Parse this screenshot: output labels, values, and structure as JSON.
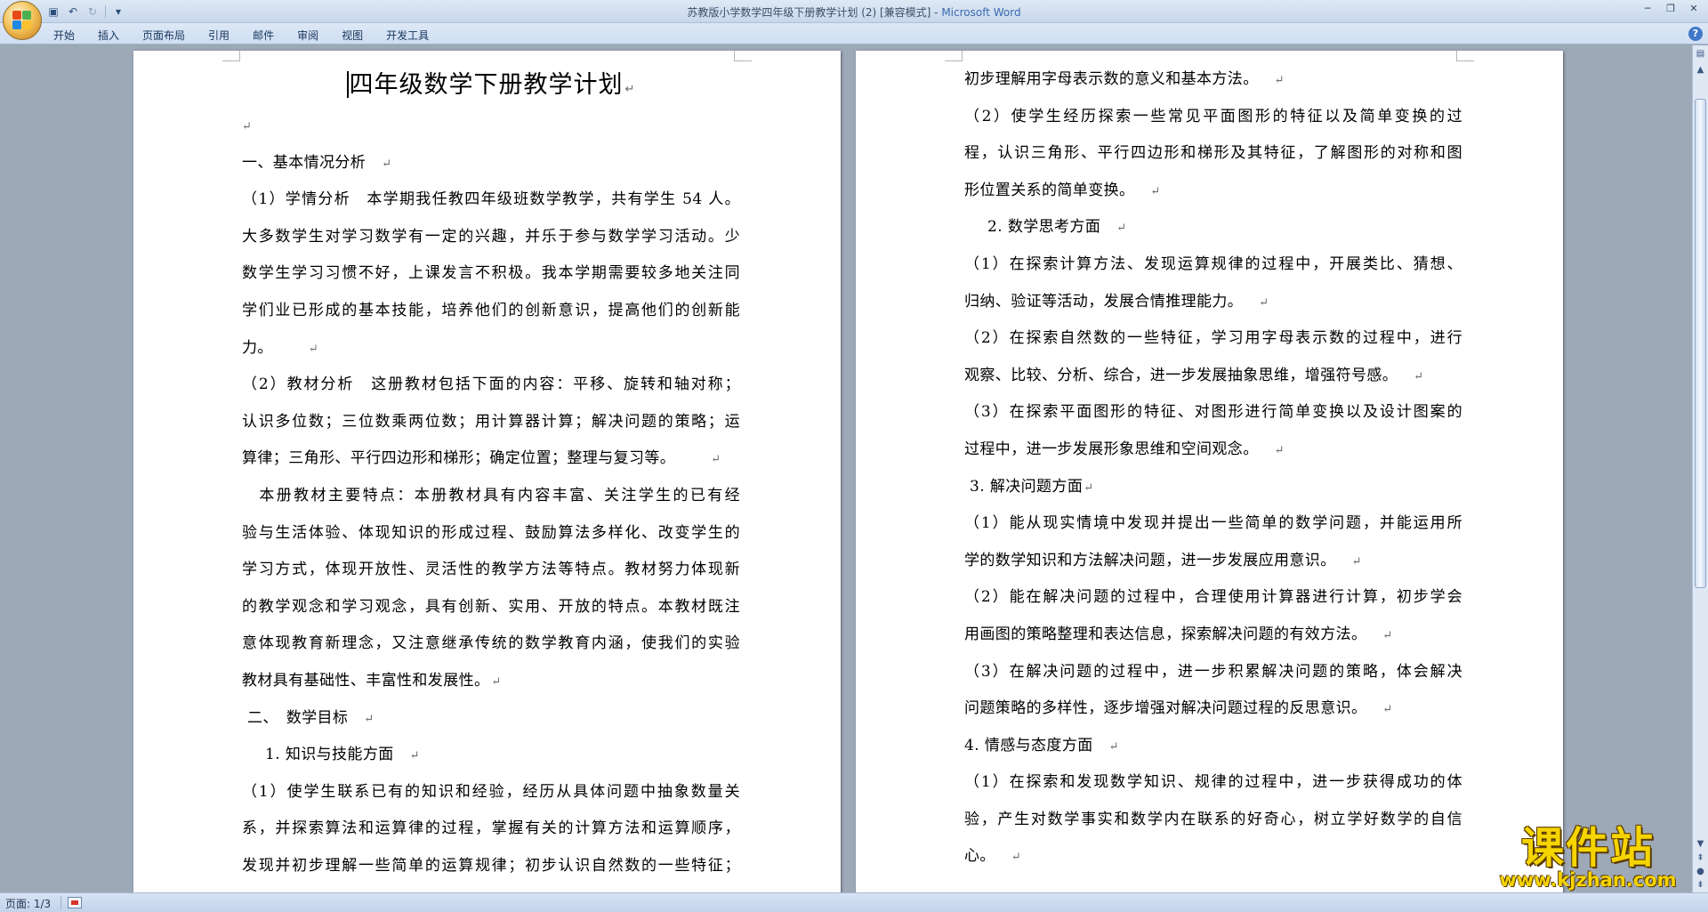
{
  "window": {
    "title_doc": "苏教版小学数学四年级下册教学计划 (2) [兼容模式] - ",
    "title_app": "Microsoft Word"
  },
  "quick_access": {
    "icons": [
      "save-icon",
      "undo-icon",
      "redo-icon",
      "customize-icon"
    ]
  },
  "ribbon": {
    "tabs": [
      "开始",
      "插入",
      "页面布局",
      "引用",
      "邮件",
      "审阅",
      "视图",
      "开发工具"
    ]
  },
  "left_page": {
    "title": "四年级数学下册教学计划",
    "lines": [
      "",
      "一、基本情况分析",
      "（1）学情分析　本学期我任教四年级班数学教学，共有学生 54 人。",
      "大多数学生对学习数学有一定的兴趣，并乐于参与数学学习活动。少",
      "数学生学习习惯不好，上课发言不积极。我本学期需要较多地关注同",
      "学们业已形成的基本技能，培养他们的创新意识，提高他们的创新能",
      "力。",
      "（2）教材分析　这册教材包括下面的内容：平移、旋转和轴对称；",
      "认识多位数；三位数乘两位数；用计算器计算；解决问题的策略；运",
      "算律；三角形、平行四边形和梯形；确定位置；整理与复习等。",
      "　本册教材主要特点：本册教材具有内容丰富、关注学生的已有经",
      "验与生活体验、体现知识的形成过程、鼓励算法多样化、改变学生的",
      "学习方式，体现开放性、灵活性的教学方法等特点。教材努力体现新",
      "的教学观念和学习观念，具有创新、实用、开放的特点。本教材既注",
      "意体现教育新理念，又注意继承传统的数学教育内涵，使我们的实验",
      "教材具有基础性、丰富性和发展性。",
      "二、　数学目标",
      "1. 知识与技能方面",
      "（1）使学生联系已有的知识和经验，经历从具体问题中抽象数量关",
      "系，并探索算法和运算律的过程，掌握有关的计算方法和运算顺序，",
      "发现并初步理解一些简单的运算规律；初步认识自然数的一些特征；"
    ]
  },
  "right_page": {
    "lines": [
      "初步理解用字母表示数的意义和基本方法。",
      "（2）使学生经历探索一些常见平面图形的特征以及简单变换的过",
      "程，认识三角形、平行四边形和梯形及其特征，了解图形的对称和图",
      "形位置关系的简单变换。",
      "2. 数学思考方面",
      "（1）在探索计算方法、发现运算规律的过程中，开展类比、猜想、",
      "归纳、验证等活动，发展合情推理能力。",
      "（2）在探索自然数的一些特征，学习用字母表示数的过程中，进行",
      "观察、比较、分析、综合，进一步发展抽象思维，增强符号感。",
      "（3）在探索平面图形的特征、对图形进行简单变换以及设计图案的",
      "过程中，进一步发展形象思维和空间观念。",
      "3. 解决问题方面",
      "（1）能从现实情境中发现并提出一些简单的数学问题，并能运用所",
      "学的数学知识和方法解决问题，进一步发展应用意识。",
      "（2）能在解决问题的过程中，合理使用计算器进行计算，初步学会",
      "用画图的策略整理和表达信息，探索解决问题的有效方法。",
      "（3）在解决问题的过程中，进一步积累解决问题的策略，体会解决",
      "问题策略的多样性，逐步增强对解决问题过程的反思意识。",
      "4. 情感与态度方面",
      "（1）在探索和发现数学知识、规律的过程中，进一步获得成功的体",
      "验，产生对数学事实和数学内在联系的好奇心，树立学好数学的自信",
      "心。"
    ]
  },
  "status_bar": {
    "page_info": "页面: 1/3"
  },
  "watermark": {
    "name": "课件站",
    "url": "www.kjzhan.com"
  }
}
